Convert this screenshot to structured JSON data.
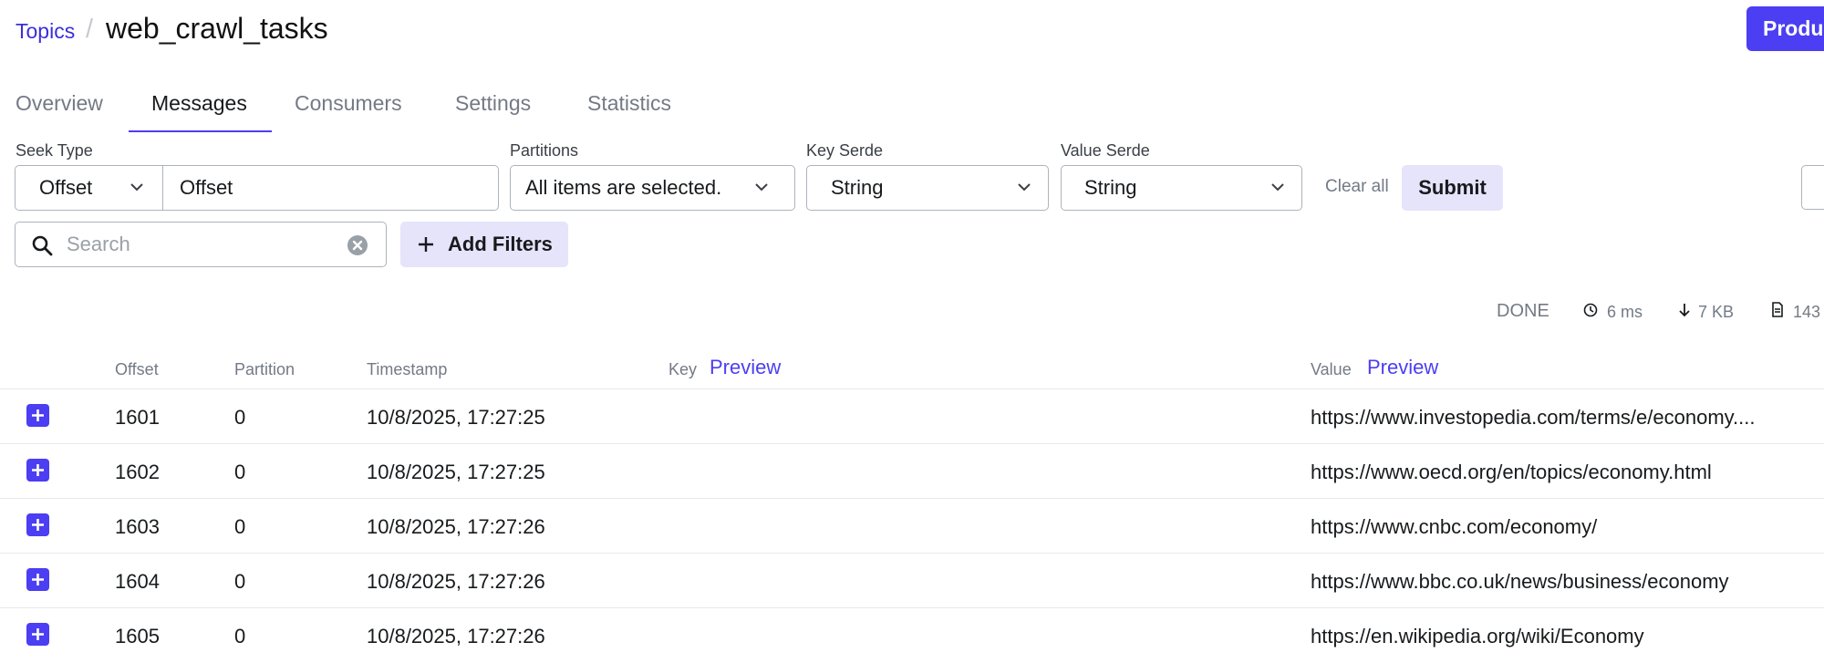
{
  "breadcrumb": {
    "topics_label": "Topics",
    "separator": "/",
    "title": "web_crawl_tasks"
  },
  "header": {
    "produce_label": "Produce"
  },
  "tabs": [
    {
      "label": "Overview"
    },
    {
      "label": "Messages"
    },
    {
      "label": "Consumers"
    },
    {
      "label": "Settings"
    },
    {
      "label": "Statistics"
    }
  ],
  "filters": {
    "seek_type_label": "Seek Type",
    "seek_type_value": "Offset",
    "seek_input_value": "Offset",
    "partitions_label": "Partitions",
    "partitions_value": "All items are selected.",
    "key_serde_label": "Key Serde",
    "key_serde_value": "String",
    "value_serde_label": "Value Serde",
    "value_serde_value": "String",
    "clear_all_label": "Clear all",
    "submit_label": "Submit"
  },
  "search": {
    "placeholder": "Search",
    "add_filters_label": "Add Filters"
  },
  "status": {
    "state": "DONE",
    "elapsed": "6 ms",
    "size": "7 KB",
    "count": "143"
  },
  "table": {
    "columns": {
      "offset": "Offset",
      "partition": "Partition",
      "timestamp": "Timestamp",
      "key": "Key",
      "key_preview": "Preview",
      "value": "Value",
      "value_preview": "Preview"
    },
    "rows": [
      {
        "offset": "1601",
        "partition": "0",
        "timestamp": "10/8/2025, 17:27:25",
        "value": "https://www.investopedia.com/terms/e/economy...."
      },
      {
        "offset": "1602",
        "partition": "0",
        "timestamp": "10/8/2025, 17:27:25",
        "value": "https://www.oecd.org/en/topics/economy.html"
      },
      {
        "offset": "1603",
        "partition": "0",
        "timestamp": "10/8/2025, 17:27:26",
        "value": "https://www.cnbc.com/economy/"
      },
      {
        "offset": "1604",
        "partition": "0",
        "timestamp": "10/8/2025, 17:27:26",
        "value": "https://www.bbc.co.uk/news/business/economy"
      },
      {
        "offset": "1605",
        "partition": "0",
        "timestamp": "10/8/2025, 17:27:26",
        "value": "https://en.wikipedia.org/wiki/Economy"
      }
    ]
  },
  "colors": {
    "accent": "#4c3ef2",
    "accent_light": "#e5e4fb",
    "muted": "#737a85"
  },
  "icons": [
    "chevron-down-icon",
    "search-icon",
    "clear-icon",
    "plus-icon",
    "clock-icon",
    "arrow-down-icon",
    "file-icon",
    "expand-icon"
  ]
}
